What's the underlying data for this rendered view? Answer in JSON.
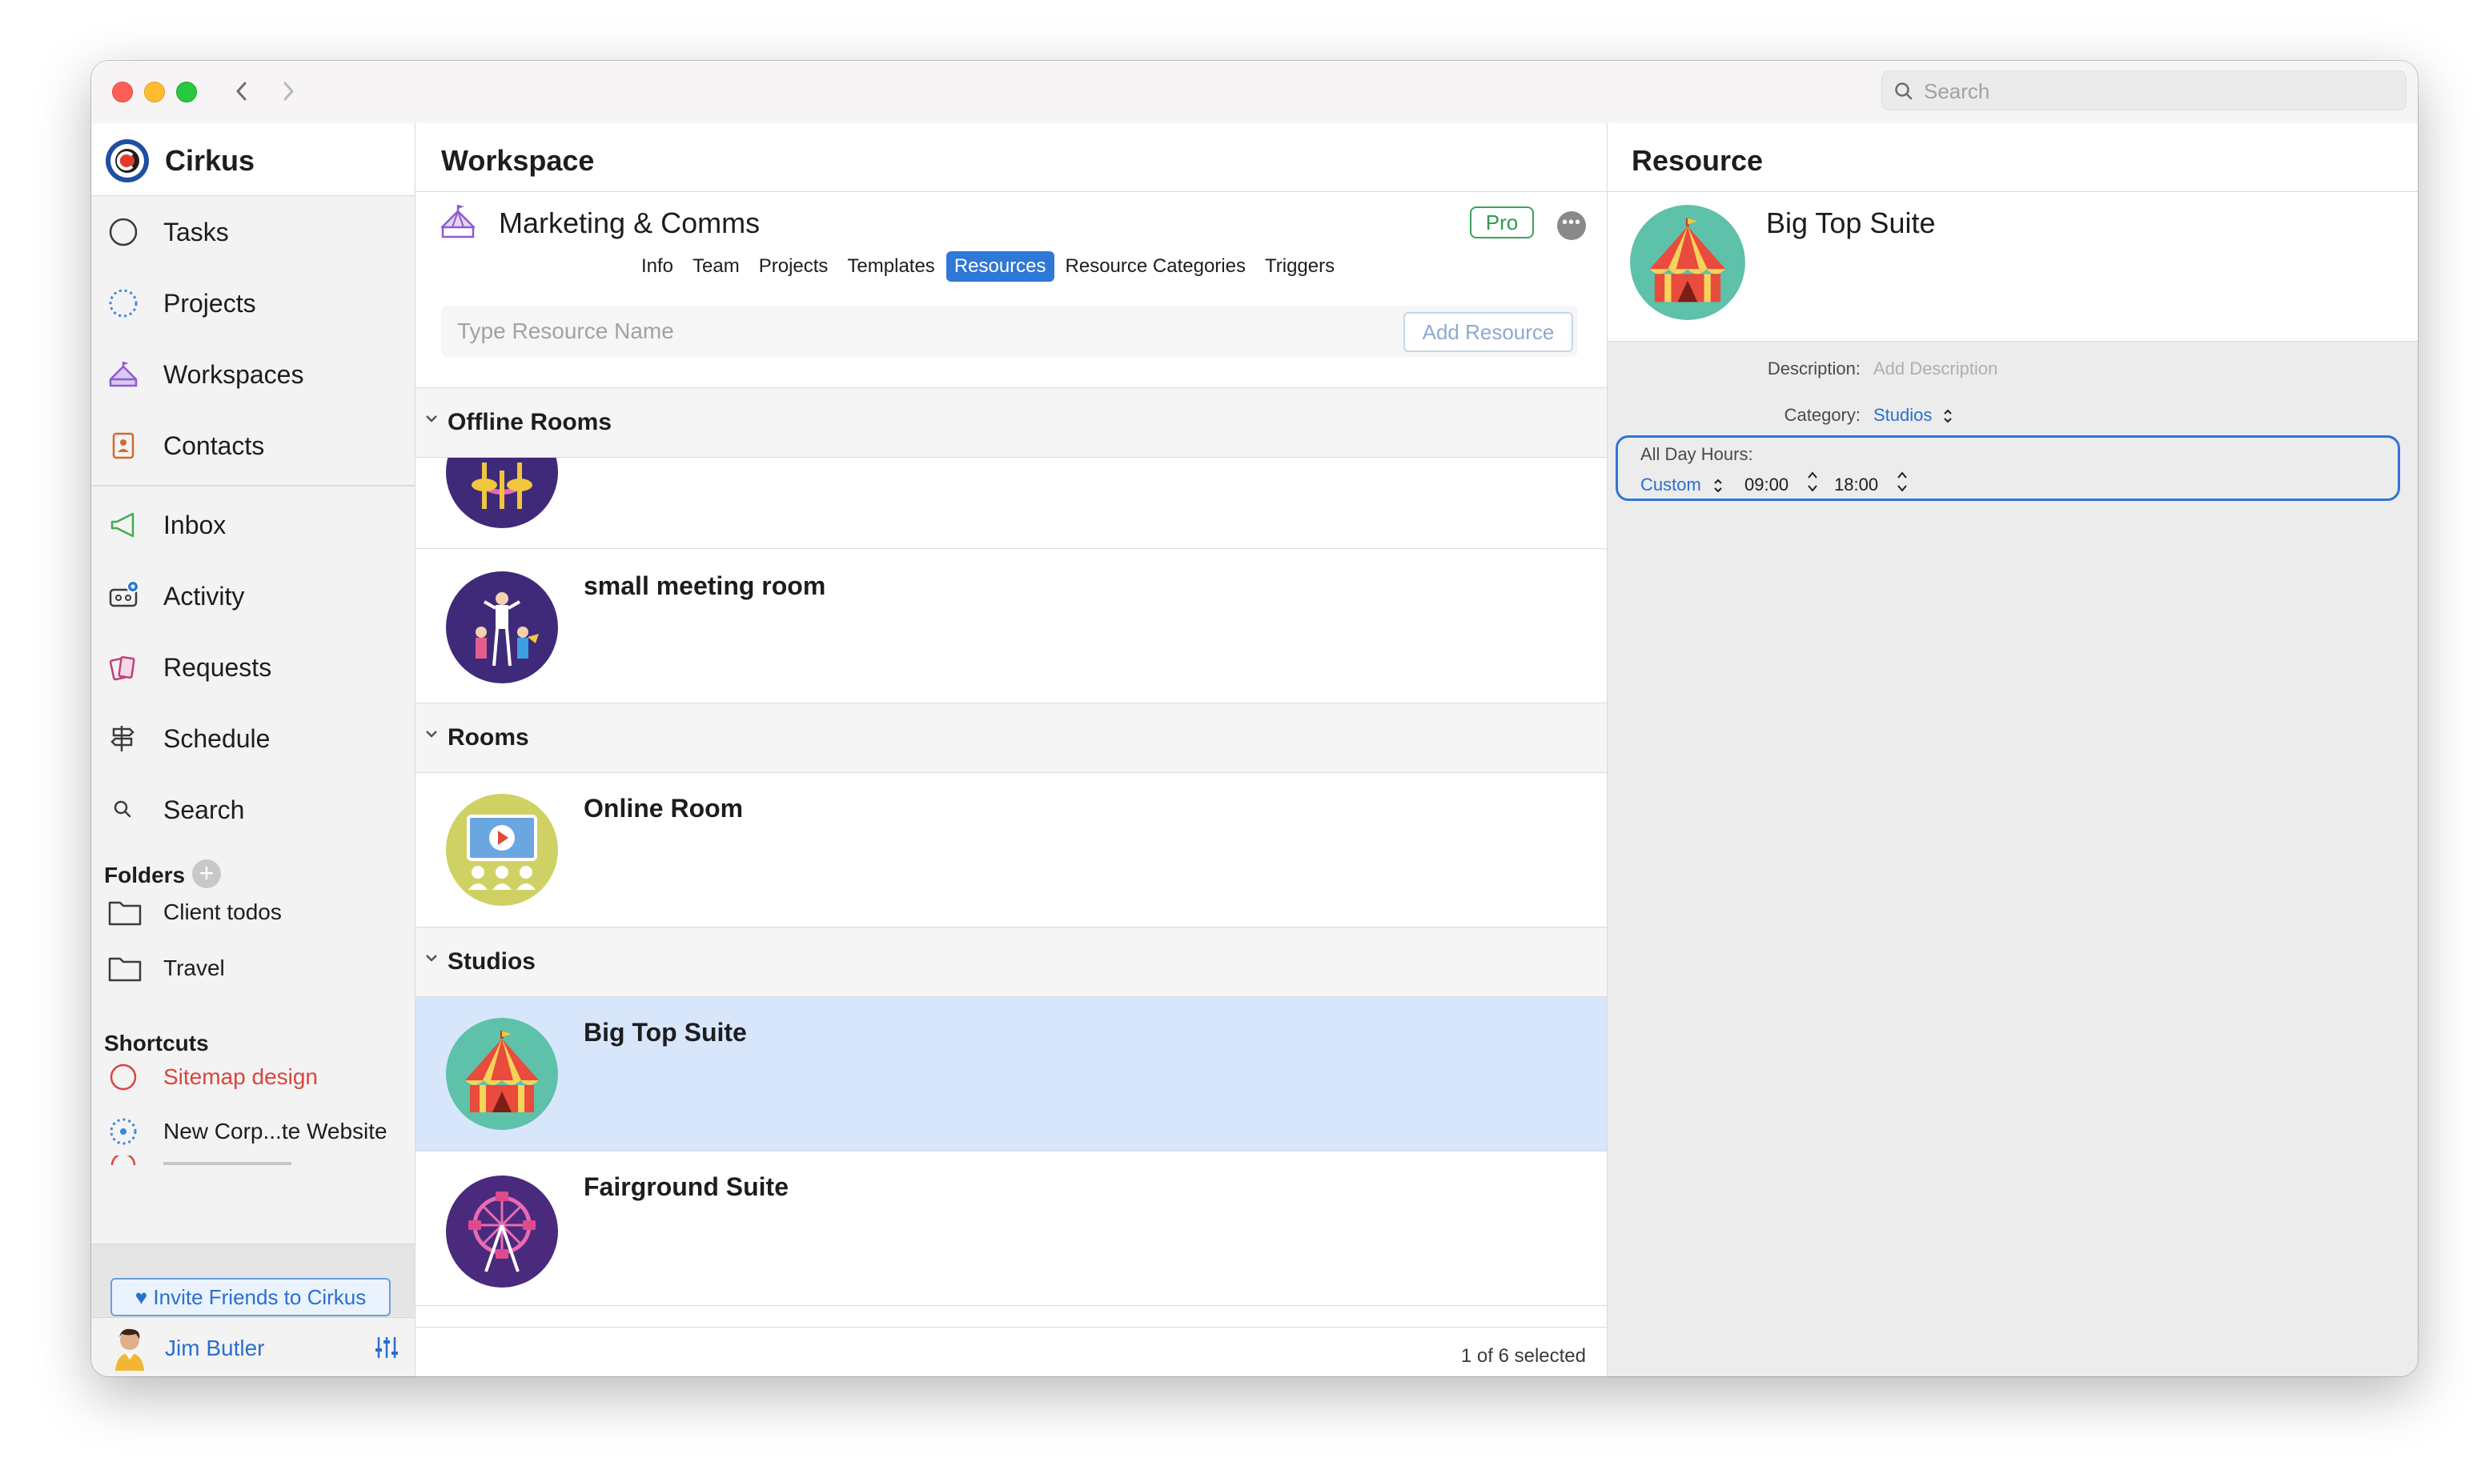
{
  "toolbar": {
    "search_placeholder": "Search"
  },
  "sidebar": {
    "app_name": "Cirkus",
    "nav": [
      {
        "label": "Tasks",
        "icon": "circle-icon"
      },
      {
        "label": "Projects",
        "icon": "dotted-circle-icon"
      },
      {
        "label": "Workspaces",
        "icon": "tent-icon"
      },
      {
        "label": "Contacts",
        "icon": "contact-book-icon"
      },
      {
        "label": "Inbox",
        "icon": "megaphone-icon"
      },
      {
        "label": "Activity",
        "icon": "tape-icon"
      },
      {
        "label": "Requests",
        "icon": "cards-icon"
      },
      {
        "label": "Schedule",
        "icon": "signpost-icon"
      },
      {
        "label": "Search",
        "icon": "search-icon"
      }
    ],
    "folders_title": "Folders",
    "folders": [
      "Client todos",
      "Travel"
    ],
    "shortcuts_title": "Shortcuts",
    "shortcuts": [
      "Sitemap design",
      "New Corp...te Website"
    ],
    "invite_label": "Invite Friends to Cirkus",
    "user_name": "Jim Butler"
  },
  "workspace": {
    "title": "Workspace",
    "name": "Marketing & Comms",
    "badge": "Pro",
    "tabs": [
      "Info",
      "Team",
      "Projects",
      "Templates",
      "Resources",
      "Resource Categories",
      "Triggers"
    ],
    "active_tab": "Resources",
    "resource_placeholder": "Type Resource Name",
    "add_resource_label": "Add Resource",
    "groups": [
      {
        "name": "Offline Rooms",
        "items": [
          "",
          "small meeting room"
        ]
      },
      {
        "name": "Rooms",
        "items": [
          "Online Room"
        ]
      },
      {
        "name": "Studios",
        "items": [
          "Big Top Suite",
          "Fairground Suite"
        ]
      }
    ],
    "selection_status": "1 of 6 selected"
  },
  "resource": {
    "title": "Resource",
    "name": "Big Top Suite",
    "description_label": "Description:",
    "description_placeholder": "Add Description",
    "category_label": "Category:",
    "category_value": "Studios",
    "hours_label": "All Day Hours:",
    "hours_mode": "Custom",
    "start_time": "09:00",
    "end_time": "18:00"
  },
  "colors": {
    "accent": "#2e78d6",
    "selected_row": "#d7e6fb",
    "pro_badge": "#3aa35b",
    "shortcut_red": "#d9453c"
  }
}
